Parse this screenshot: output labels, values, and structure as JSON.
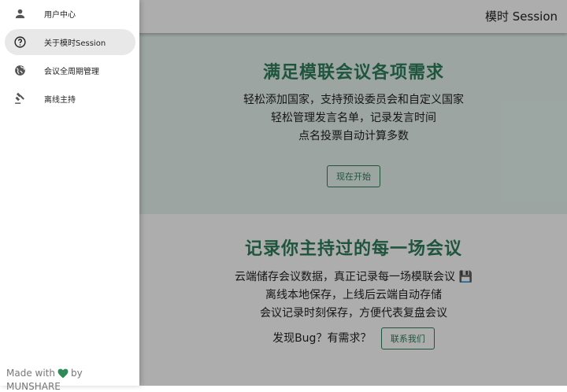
{
  "app": {
    "title": "模时 Session"
  },
  "hero1": {
    "title": "满足模联会议各项需求",
    "lines": [
      "轻松添加国家，支持预设委员会和自定义国家",
      "轻松管理发言名单，记录发言时间",
      "点名投票自动计算多数"
    ],
    "button": "现在开始"
  },
  "hero2": {
    "title": "记录你主持过的每一场会议",
    "lines": [
      "云端储存会议数据，真正记录每一场模联会议 💾",
      "离线本地保存，上线后云端自动存储",
      "会议记录时刻保存，方便代表复盘会议"
    ],
    "bug_text": "发现Bug？有需求？",
    "contact_button": "联系我们"
  },
  "drawer": {
    "items": [
      {
        "label": "用户中心",
        "icon": "person-icon"
      },
      {
        "label": "关于模时Session",
        "icon": "help-icon"
      },
      {
        "label": "会议全周期管理",
        "icon": "globe-icon"
      },
      {
        "label": "离线主持",
        "icon": "gavel-icon"
      }
    ],
    "active_index": 1,
    "footer": {
      "made_with": "Made with",
      "by": "by MUNSHARE"
    }
  },
  "colors": {
    "accent": "#2e7d5b",
    "heart": "#2e8b57"
  }
}
